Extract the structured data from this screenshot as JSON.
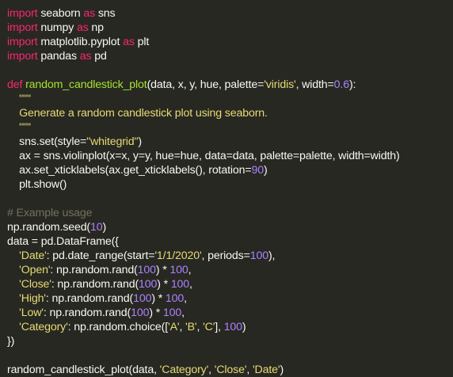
{
  "colors": {
    "background": "#272822",
    "plain": "#f8f8f2",
    "keyword": "#f92672",
    "function": "#a6e22e",
    "string": "#e6db74",
    "number": "#ae81ff",
    "comment": "#75715e"
  },
  "code": {
    "lines": [
      [
        {
          "t": "kw",
          "s": "import"
        },
        {
          "t": "pl",
          "s": " seaborn "
        },
        {
          "t": "kw",
          "s": "as"
        },
        {
          "t": "pl",
          "s": " sns"
        }
      ],
      [
        {
          "t": "kw",
          "s": "import"
        },
        {
          "t": "pl",
          "s": " numpy "
        },
        {
          "t": "kw",
          "s": "as"
        },
        {
          "t": "pl",
          "s": " np"
        }
      ],
      [
        {
          "t": "kw",
          "s": "import"
        },
        {
          "t": "pl",
          "s": " matplotlib.pyplot "
        },
        {
          "t": "kw",
          "s": "as"
        },
        {
          "t": "pl",
          "s": " plt"
        }
      ],
      [
        {
          "t": "kw",
          "s": "import"
        },
        {
          "t": "pl",
          "s": " pandas "
        },
        {
          "t": "kw",
          "s": "as"
        },
        {
          "t": "pl",
          "s": " pd"
        }
      ],
      [],
      [
        {
          "t": "kw",
          "s": "def"
        },
        {
          "t": "pl",
          "s": " "
        },
        {
          "t": "fn",
          "s": "random_candlestick_plot"
        },
        {
          "t": "pl",
          "s": "(data, x, y, hue, palette="
        },
        {
          "t": "str",
          "s": "'viridis'"
        },
        {
          "t": "pl",
          "s": ", width="
        },
        {
          "t": "num",
          "s": "0.6"
        },
        {
          "t": "pl",
          "s": "):"
        }
      ],
      [
        {
          "t": "pl",
          "s": "    "
        },
        {
          "t": "str",
          "s": "\"\"\""
        }
      ],
      [
        {
          "t": "str",
          "s": "    Generate a random candlestick plot using seaborn."
        }
      ],
      [
        {
          "t": "str",
          "s": "    \"\"\""
        }
      ],
      [
        {
          "t": "pl",
          "s": "    sns.set(style="
        },
        {
          "t": "str",
          "s": "\"whitegrid\""
        },
        {
          "t": "pl",
          "s": ")"
        }
      ],
      [
        {
          "t": "pl",
          "s": "    ax = sns.violinplot(x=x, y=y, hue=hue, data=data, palette=palette, width=width)"
        }
      ],
      [
        {
          "t": "pl",
          "s": "    ax.set_xticklabels(ax.get_xticklabels(), rotation="
        },
        {
          "t": "num",
          "s": "90"
        },
        {
          "t": "pl",
          "s": ")"
        }
      ],
      [
        {
          "t": "pl",
          "s": "    plt.show()"
        }
      ],
      [],
      [
        {
          "t": "cm",
          "s": "# Example usage"
        }
      ],
      [
        {
          "t": "pl",
          "s": "np.random.seed("
        },
        {
          "t": "num",
          "s": "10"
        },
        {
          "t": "pl",
          "s": ")"
        }
      ],
      [
        {
          "t": "pl",
          "s": "data = pd.DataFrame({"
        }
      ],
      [
        {
          "t": "pl",
          "s": "    "
        },
        {
          "t": "str",
          "s": "'Date'"
        },
        {
          "t": "pl",
          "s": ": pd.date_range(start="
        },
        {
          "t": "str",
          "s": "'1/1/2020'"
        },
        {
          "t": "pl",
          "s": ", periods="
        },
        {
          "t": "num",
          "s": "100"
        },
        {
          "t": "pl",
          "s": "),"
        }
      ],
      [
        {
          "t": "pl",
          "s": "    "
        },
        {
          "t": "str",
          "s": "'Open'"
        },
        {
          "t": "pl",
          "s": ": np.random.rand("
        },
        {
          "t": "num",
          "s": "100"
        },
        {
          "t": "pl",
          "s": ") * "
        },
        {
          "t": "num",
          "s": "100"
        },
        {
          "t": "pl",
          "s": ","
        }
      ],
      [
        {
          "t": "pl",
          "s": "    "
        },
        {
          "t": "str",
          "s": "'Close'"
        },
        {
          "t": "pl",
          "s": ": np.random.rand("
        },
        {
          "t": "num",
          "s": "100"
        },
        {
          "t": "pl",
          "s": ") * "
        },
        {
          "t": "num",
          "s": "100"
        },
        {
          "t": "pl",
          "s": ","
        }
      ],
      [
        {
          "t": "pl",
          "s": "    "
        },
        {
          "t": "str",
          "s": "'High'"
        },
        {
          "t": "pl",
          "s": ": np.random.rand("
        },
        {
          "t": "num",
          "s": "100"
        },
        {
          "t": "pl",
          "s": ") * "
        },
        {
          "t": "num",
          "s": "100"
        },
        {
          "t": "pl",
          "s": ","
        }
      ],
      [
        {
          "t": "pl",
          "s": "    "
        },
        {
          "t": "str",
          "s": "'Low'"
        },
        {
          "t": "pl",
          "s": ": np.random.rand("
        },
        {
          "t": "num",
          "s": "100"
        },
        {
          "t": "pl",
          "s": ") * "
        },
        {
          "t": "num",
          "s": "100"
        },
        {
          "t": "pl",
          "s": ","
        }
      ],
      [
        {
          "t": "pl",
          "s": "    "
        },
        {
          "t": "str",
          "s": "'Category'"
        },
        {
          "t": "pl",
          "s": ": np.random.choice(["
        },
        {
          "t": "str",
          "s": "'A'"
        },
        {
          "t": "pl",
          "s": ", "
        },
        {
          "t": "str",
          "s": "'B'"
        },
        {
          "t": "pl",
          "s": ", "
        },
        {
          "t": "str",
          "s": "'C'"
        },
        {
          "t": "pl",
          "s": "], "
        },
        {
          "t": "num",
          "s": "100"
        },
        {
          "t": "pl",
          "s": ")"
        }
      ],
      [
        {
          "t": "pl",
          "s": "})"
        }
      ],
      [],
      [
        {
          "t": "pl",
          "s": "random_candlestick_plot(data, "
        },
        {
          "t": "str",
          "s": "'Category'"
        },
        {
          "t": "pl",
          "s": ", "
        },
        {
          "t": "str",
          "s": "'Close'"
        },
        {
          "t": "pl",
          "s": ", "
        },
        {
          "t": "str",
          "s": "'Date'"
        },
        {
          "t": "pl",
          "s": ")"
        }
      ]
    ]
  }
}
